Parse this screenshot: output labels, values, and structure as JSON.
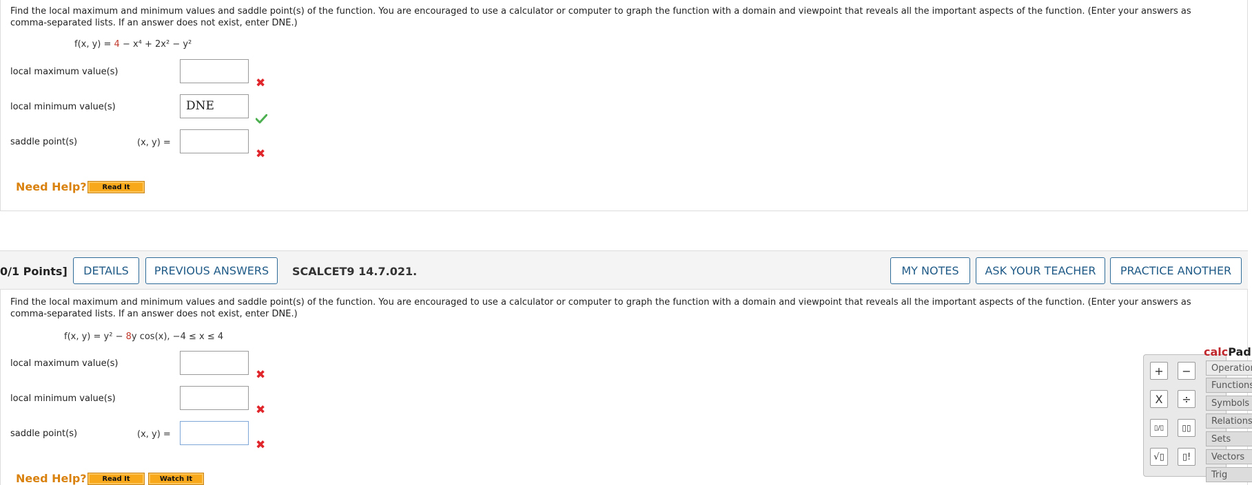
{
  "question1": {
    "text": "Find the local maximum and minimum values and saddle point(s) of the function. You are encouraged to use a calculator or computer to graph the function with a domain and viewpoint that reveals all the important aspects of the function. (Enter your answers as comma-separated lists. If an answer does not exist, enter DNE.)",
    "function_lhs": "f(x, y) = ",
    "function_const": "4",
    "function_rest": " − x⁴ + 2x² − y²",
    "local_max_label": "local maximum value(s)",
    "local_max_value": "",
    "local_max_status": "incorrect",
    "local_min_label": "local minimum value(s)",
    "local_min_value": "DNE",
    "local_min_status": "correct",
    "saddle_label": "saddle point(s)",
    "saddle_prefix": "(x, y) =",
    "saddle_value": "",
    "saddle_status": "incorrect",
    "need_help": "Need Help?",
    "read_it": "Read It"
  },
  "question2_header": {
    "points": "0/1 Points]",
    "details": "DETAILS",
    "previous_answers": "PREVIOUS ANSWERS",
    "reference": "SCALCET9 14.7.021.",
    "my_notes": "MY NOTES",
    "ask_teacher": "ASK YOUR TEACHER",
    "practice_another": "PRACTICE ANOTHER"
  },
  "question2": {
    "text": "Find the local maximum and minimum values and saddle point(s) of the function. You are encouraged to use a calculator or computer to graph the function with a domain and viewpoint that reveals all the important aspects of the function. (Enter your answers as comma-separated lists. If an answer does not exist, enter DNE.)",
    "function_lhs": "f(x, y) = y² − ",
    "function_coef": "8",
    "function_rest": "y cos(x),   −4 ≤ x ≤ 4",
    "local_max_label": "local maximum value(s)",
    "local_max_value": "",
    "local_max_status": "incorrect",
    "local_min_label": "local minimum value(s)",
    "local_min_value": "",
    "local_min_status": "incorrect",
    "saddle_label": "saddle point(s)",
    "saddle_prefix": "(x, y) =",
    "saddle_value": "",
    "saddle_status": "incorrect",
    "need_help": "Need Help?",
    "read_it": "Read It",
    "watch_it": "Watch It"
  },
  "calcpad": {
    "title_calc": "calc",
    "title_pad": "Pad",
    "tabs": [
      "Operations",
      "Functions",
      "Symbols",
      "Relations",
      "Sets",
      "Vectors",
      "Trig"
    ],
    "buttons": [
      "+",
      "−",
      "X",
      "÷",
      "▯/▯",
      "▯▯",
      "√▯",
      "▯!"
    ]
  },
  "colors": {
    "accent_blue": "#1f5a87",
    "need_help_orange": "#d9820f",
    "incorrect_red": "#e0262b",
    "correct_green": "#4caf50"
  }
}
